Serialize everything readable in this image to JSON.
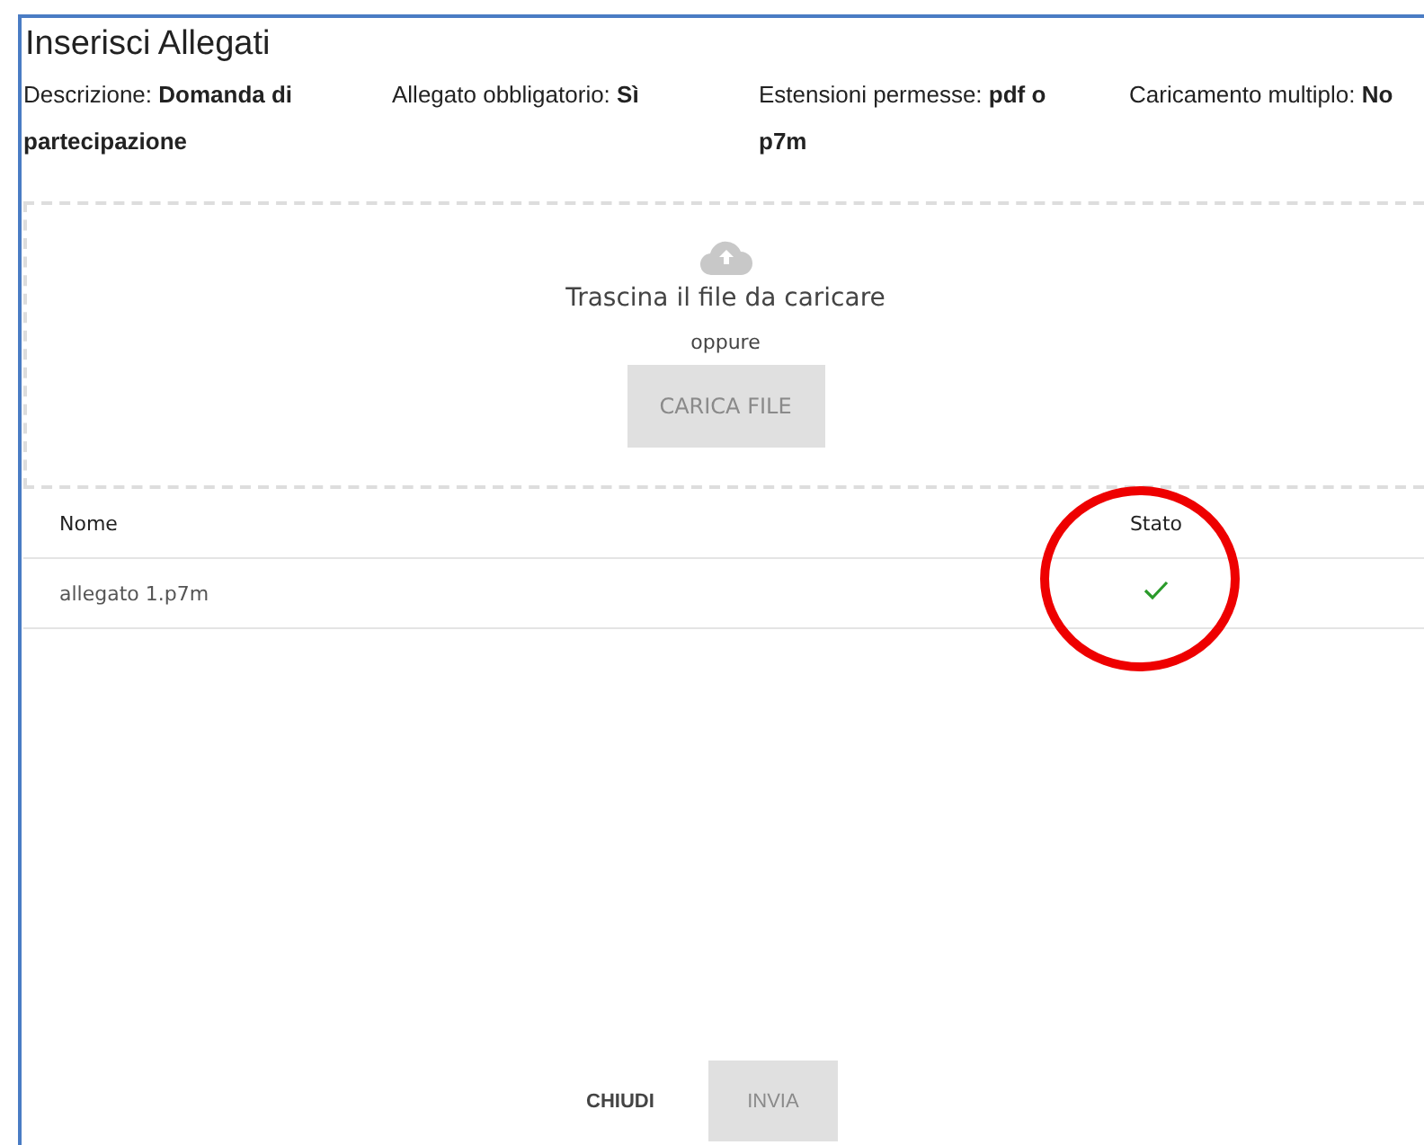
{
  "dialog": {
    "title": "Inserisci Allegati",
    "details": [
      {
        "label": "Descrizione:",
        "value": "Domanda di partecipazione"
      },
      {
        "label": "Allegato obbligatorio:",
        "value": "Sì"
      },
      {
        "label": "Estensioni permesse:",
        "value": "pdf o p7m"
      },
      {
        "label": "Caricamento multiplo:",
        "value": "No"
      }
    ],
    "dropzone": {
      "hint": "Trascina il file da caricare",
      "or": "oppure",
      "button": {
        "label": "CARICA FILE",
        "disabled": true
      }
    },
    "table": {
      "columns": [
        "Nome",
        "Stato"
      ],
      "rows": [
        {
          "name": "allegato 1.p7m",
          "uploaded": true
        }
      ]
    },
    "buttons": [
      {
        "label": "CHIUDI",
        "disabled": false
      },
      {
        "label": "INVIA",
        "disabled": true
      }
    ]
  },
  "annotation": {
    "kind": "circle"
  }
}
